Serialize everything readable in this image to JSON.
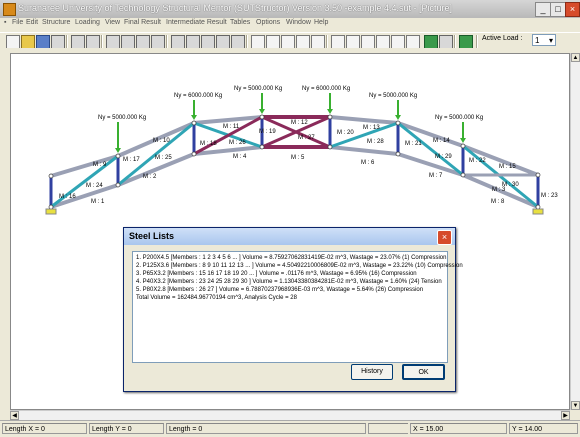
{
  "window": {
    "title": "Suranaree University of Technology Structural Mentor (SUTStructor) Version 3.50 -example 4.4.sut - [Picture]"
  },
  "menu": [
    "File",
    "Edit",
    "Structure",
    "Loading",
    "View",
    "Final Result",
    "Intermediate Result",
    "Tables",
    "Options",
    "Window",
    "Help"
  ],
  "toolbar": {
    "active_load_label": "Active Load :",
    "active_load_value": "1"
  },
  "structure": {
    "loads": [
      "Ny = 5000.000 Kg",
      "Ny = 6000.000 Kg",
      "Ny = 5000.000 Kg",
      "Ny = 6000.000 Kg",
      "Ny = 5000.000 Kg",
      "Ny = 5000.000 Kg"
    ],
    "members": [
      "M : 1",
      "M : 2",
      "M : 3",
      "M : 4",
      "M : 5",
      "M : 6",
      "M : 7",
      "M : 8",
      "M : 9",
      "M : 10",
      "M : 11",
      "M : 12",
      "M : 13",
      "M : 14",
      "M : 15",
      "M : 16",
      "M : 17",
      "M : 18",
      "M : 19",
      "M : 20",
      "M : 21",
      "M : 22",
      "M : 23",
      "M : 24",
      "M : 25",
      "M : 26",
      "M : 27",
      "M : 28",
      "M : 29",
      "M : 30"
    ]
  },
  "dialog": {
    "title": "Steel Lists",
    "lines": [
      "1. P200X4.5  [Members : 1 2 3 4 5 6 ... ] Volume = 8.75927062831419E-02 m^3, Wastage = 23.07% (1) Compression",
      "2. P125X3.6  [Members : 8 9 10 11 12 13 ... ] Volume = 4.50492210006809E-02 m^3, Wastage = 23.22% (10) Compression",
      "3. P65X3.2  [Members : 15 16 17 18 19 20 ... ] Volume = .01176 m^3, Wastage = 6.95% (16) Compression",
      "4. P40X3.2  [Members : 23 24 25 28 29 30 ] Volume = 1.13043380384281E-02 m^3, Wastage = 1.60% (24) Tension",
      "5. P80X2.8  [Members : 26 27 ] Volume = 6.78870237968936E-03 m^3, Wastage = 5.64% (26) Compression",
      "Total Volume = 162484.96770194 cm^3, Analysis Cycle = 28"
    ],
    "history_button": "History",
    "ok_button": "OK"
  },
  "status": {
    "length_x": "Length X = 0",
    "length_y": "Length Y = 0",
    "length": "Length = 0",
    "x": "X = 15.00",
    "y": "Y = 14.00"
  },
  "colors": {
    "chord": "#9aa0b4",
    "web_blue": "#2fa5b5",
    "web_magenta": "#8a2a5a",
    "vertical": "#3040a0",
    "load_arrow": "#39b030"
  }
}
